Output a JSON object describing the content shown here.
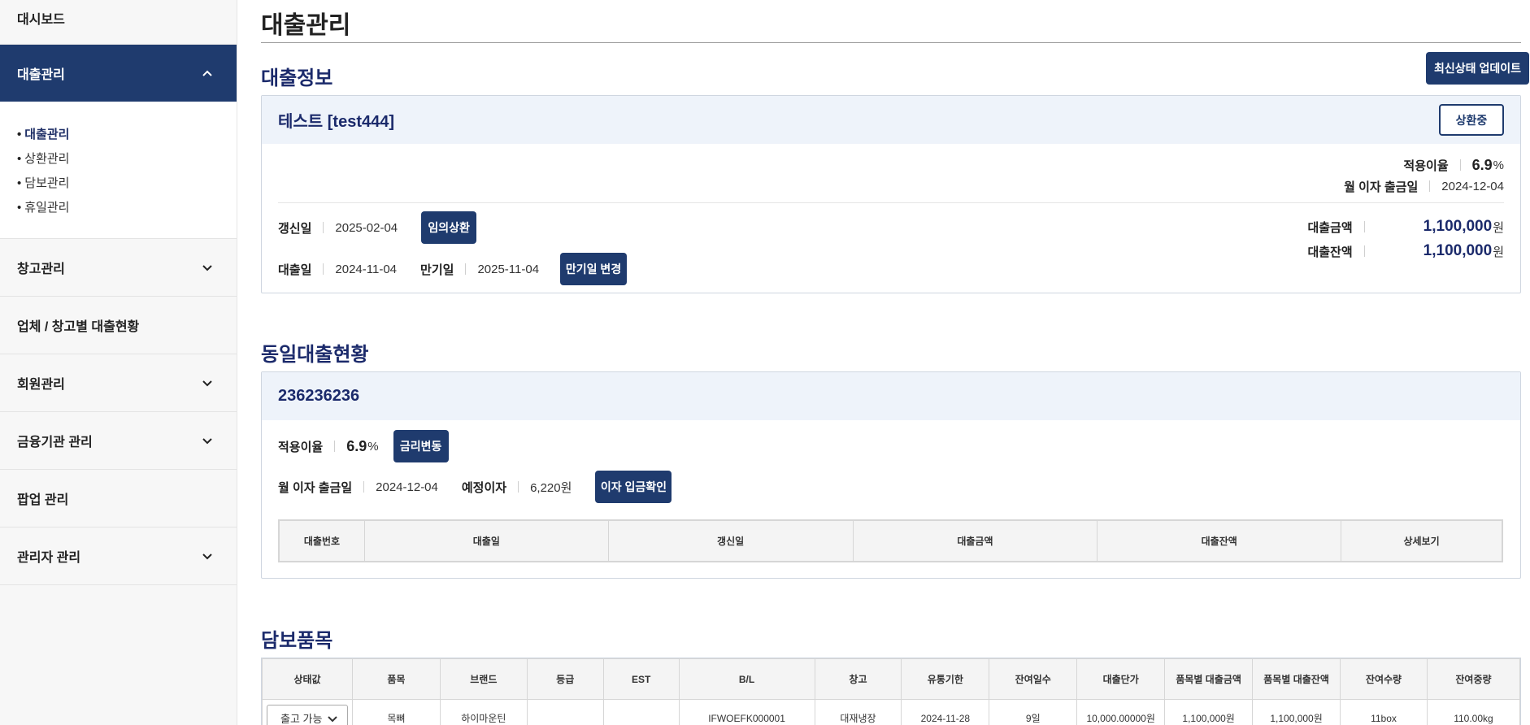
{
  "sidebar": {
    "dashboard": "대시보드",
    "loan_mgmt": "대출관리",
    "sub_items": [
      "대출관리",
      "상환관리",
      "담보관리",
      "휴일관리"
    ],
    "warehouse_mgmt": "창고관리",
    "company_loans": "업체 / 창고별 대출현황",
    "member_mgmt": "회원관리",
    "finance_mgmt": "금융기관 관리",
    "popup_mgmt": "팝업 관리",
    "admin_mgmt": "관리자 관리"
  },
  "page": {
    "title": "대출관리"
  },
  "loan_info": {
    "section_title": "대출정보",
    "update_button": "최신상태 업데이트",
    "borrower": "테스트 [test444]",
    "status_button": "상환중",
    "applied_rate_label": "적용이율",
    "applied_rate_value": "6.9",
    "rate_unit": "%",
    "interest_date_label": "월 이자 출금일",
    "interest_date_value": "2024-12-04",
    "renewal_label": "갱신일",
    "renewal_value": "2025-02-04",
    "early_repay_button": "임의상환",
    "loan_date_label": "대출일",
    "loan_date_value": "2024-11-04",
    "maturity_label": "만기일",
    "maturity_value": "2025-11-04",
    "change_maturity_button": "만기일 변경",
    "amount_label": "대출금액",
    "amount_value": "1,100,000",
    "balance_label": "대출잔액",
    "balance_value": "1,100,000",
    "won": "원"
  },
  "same_loan": {
    "section_title": "동일대출현황",
    "id": "236236236",
    "applied_rate_label": "적용이율",
    "applied_rate_value": "6.9",
    "rate_unit": "%",
    "rate_change_button": "금리변동",
    "interest_date_label": "월 이자 출금일",
    "interest_date_value": "2024-12-04",
    "expected_label": "예정이자",
    "expected_value": "6,220원",
    "confirm_button": "이자 입금확인",
    "table_headers": [
      "대출번호",
      "대출일",
      "갱신일",
      "대출금액",
      "대출잔액",
      "상세보기"
    ]
  },
  "collateral": {
    "section_title": "담보품목",
    "headers": [
      "상태값",
      "품목",
      "브랜드",
      "등급",
      "EST",
      "B/L",
      "창고",
      "유통기한",
      "잔여일수",
      "대출단가",
      "품목별 대출금액",
      "품목별 대출잔액",
      "잔여수량",
      "잔여중량"
    ],
    "rows": [
      {
        "status": "출고 가능",
        "item": "목뼈",
        "brand": "하이마운틴",
        "grade": "",
        "est": "",
        "bl": "IFWOEFK000001",
        "warehouse": "대재냉장",
        "expiry": "2024-11-28",
        "days": "9일",
        "unit_price": "10,000.00000원",
        "item_amount": "1,100,000원",
        "item_balance": "1,100,000원",
        "qty": "11box",
        "weight": "110.00kg"
      }
    ]
  }
}
